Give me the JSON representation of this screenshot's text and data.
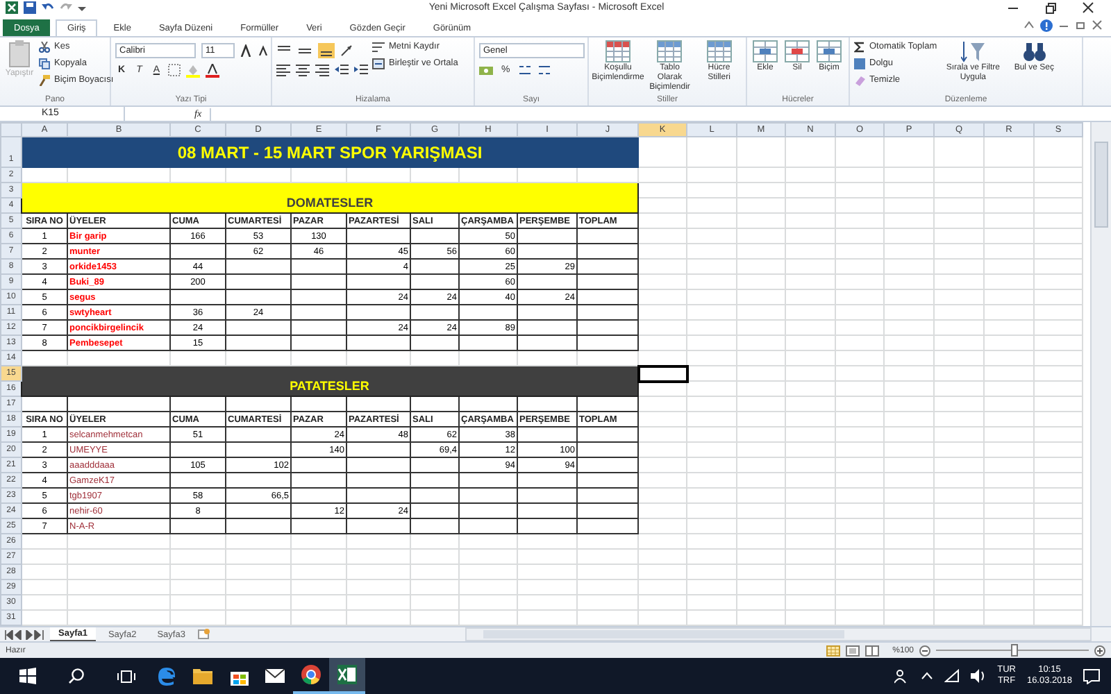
{
  "window": {
    "title": "Yeni Microsoft Excel Çalışma Sayfası - Microsoft Excel"
  },
  "ribbon_tabs": [
    {
      "label": "Dosya",
      "kind": "file",
      "selected": false
    },
    {
      "label": "Giriş",
      "kind": "tab",
      "selected": true
    },
    {
      "label": "Ekle",
      "kind": "tab",
      "selected": false
    },
    {
      "label": "Sayfa Düzeni",
      "kind": "tab",
      "selected": false
    },
    {
      "label": "Formüller",
      "kind": "tab",
      "selected": false
    },
    {
      "label": "Veri",
      "kind": "tab",
      "selected": false
    },
    {
      "label": "Gözden Geçir",
      "kind": "tab",
      "selected": false
    },
    {
      "label": "Görünüm",
      "kind": "tab",
      "selected": false
    }
  ],
  "ribbon": {
    "clipboard": {
      "label": "Pano",
      "paste": {
        "label": "Yapıştır",
        "disabled": true
      },
      "cut": "Kes",
      "copy": "Kopyala",
      "format_painter": "Biçim Boyacısı"
    },
    "font": {
      "label": "Yazı Tipi",
      "family": "Calibri",
      "size": "11",
      "bold": "K",
      "italic": "T",
      "underline": "A"
    },
    "alignment": {
      "label": "Hizalama",
      "wrap": "Metni Kaydır",
      "merge": "Birleştir ve Ortala"
    },
    "number": {
      "label": "Sayı",
      "format": "Genel",
      "percent": "%"
    },
    "styles": {
      "label": "Stiller",
      "buttons": [
        "Koşullu Biçimlendirme",
        "Tablo Olarak Biçimlendir",
        "Hücre Stilleri"
      ]
    },
    "cells": {
      "label": "Hücreler",
      "buttons": [
        "Ekle",
        "Sil",
        "Biçim"
      ]
    },
    "editing": {
      "label": "Düzenleme",
      "autosum": "Otomatik Toplam",
      "fill": "Dolgu",
      "clear": "Temizle",
      "sort": "Sırala ve Filtre Uygula",
      "find": "Bul ve Seç"
    }
  },
  "formula_bar": {
    "name_box": "K15",
    "function_label": "fx"
  },
  "columns": [
    {
      "label": "A",
      "selected": false
    },
    {
      "label": "B",
      "selected": false
    },
    {
      "label": "C",
      "selected": false
    },
    {
      "label": "D",
      "selected": false
    },
    {
      "label": "E",
      "selected": false
    },
    {
      "label": "F",
      "selected": false
    },
    {
      "label": "G",
      "selected": false
    },
    {
      "label": "H",
      "selected": false
    },
    {
      "label": "I",
      "selected": false
    },
    {
      "label": "J",
      "selected": false
    },
    {
      "label": "K",
      "selected": true
    },
    {
      "label": "L",
      "selected": false
    },
    {
      "label": "M",
      "selected": false
    },
    {
      "label": "N",
      "selected": false
    },
    {
      "label": "O",
      "selected": false
    },
    {
      "label": "P",
      "selected": false
    },
    {
      "label": "Q",
      "selected": false
    },
    {
      "label": "R",
      "selected": false
    },
    {
      "label": "S",
      "selected": false
    }
  ],
  "row_headers": [
    {
      "label": "1",
      "selected": false
    },
    {
      "label": "2",
      "selected": false
    },
    {
      "label": "3",
      "selected": false
    },
    {
      "label": "4",
      "selected": false
    },
    {
      "label": "5",
      "selected": false
    },
    {
      "label": "6",
      "selected": false
    },
    {
      "label": "7",
      "selected": false
    },
    {
      "label": "8",
      "selected": false
    },
    {
      "label": "9",
      "selected": false
    },
    {
      "label": "10",
      "selected": false
    },
    {
      "label": "11",
      "selected": false
    },
    {
      "label": "12",
      "selected": false
    },
    {
      "label": "13",
      "selected": false
    },
    {
      "label": "14",
      "selected": false
    },
    {
      "label": "15",
      "selected": true
    },
    {
      "label": "16",
      "selected": false
    },
    {
      "label": "17",
      "selected": false
    },
    {
      "label": "18",
      "selected": false
    },
    {
      "label": "19",
      "selected": false
    },
    {
      "label": "20",
      "selected": false
    },
    {
      "label": "21",
      "selected": false
    },
    {
      "label": "22",
      "selected": false
    },
    {
      "label": "23",
      "selected": false
    },
    {
      "label": "24",
      "selected": false
    },
    {
      "label": "25",
      "selected": false
    },
    {
      "label": "26",
      "selected": false
    },
    {
      "label": "27",
      "selected": false
    },
    {
      "label": "28",
      "selected": false
    },
    {
      "label": "29",
      "selected": false
    },
    {
      "label": "30",
      "selected": false
    },
    {
      "label": "31",
      "selected": false
    }
  ],
  "sheet": {
    "title": "08 MART - 15 MART SPOR YARIŞMASI",
    "sections": [
      {
        "title": "DOMATESLER",
        "color": "#ffff00",
        "names": {
          "color": "#ff0000",
          "bold": true
        },
        "blank_row": false,
        "columns": [
          {
            "label": "SIRA NO",
            "kind": "centered"
          },
          {
            "label": "ÜYELER",
            "kind": "text"
          },
          {
            "label": "CUMA",
            "kind": "centered"
          },
          {
            "label": "CUMARTESİ",
            "kind": "centered"
          },
          {
            "label": "PAZAR",
            "kind": "centered"
          },
          {
            "label": "PAZARTESİ",
            "kind": "numeric"
          },
          {
            "label": "SALI",
            "kind": "numeric"
          },
          {
            "label": "ÇARŞAMBA",
            "kind": "numeric"
          },
          {
            "label": "PERŞEMBE",
            "kind": "numeric"
          },
          {
            "label": "TOPLAM"
          }
        ],
        "rows": [
          {
            "cells": [
              "1",
              "Bir garip",
              "166",
              "53",
              "130",
              null,
              null,
              "50",
              null,
              null
            ]
          },
          {
            "cells": [
              "2",
              "munter",
              null,
              "62",
              "46",
              "45",
              "56",
              "60",
              null,
              null
            ]
          },
          {
            "cells": [
              "3",
              "orkide1453",
              "44",
              null,
              null,
              "4",
              null,
              "25",
              "29",
              null
            ]
          },
          {
            "cells": [
              "4",
              "Buki_89",
              "200",
              null,
              null,
              null,
              null,
              "60",
              null,
              null
            ]
          },
          {
            "cells": [
              "5",
              "segus",
              null,
              null,
              null,
              "24",
              "24",
              "40",
              "24",
              null
            ]
          },
          {
            "cells": [
              "6",
              "swtyheart",
              "36",
              "24",
              null,
              null,
              null,
              null,
              null,
              null
            ]
          },
          {
            "cells": [
              "7",
              "poncikbirgelincik",
              "24",
              null,
              null,
              "24",
              "24",
              "89",
              null,
              null
            ]
          },
          {
            "cells": [
              "8",
              "Pembesepet",
              "15",
              null,
              null,
              null,
              null,
              null,
              null,
              null
            ]
          }
        ]
      },
      {
        "title": "PATATESLER",
        "color": "#404040",
        "names": {
          "color": "#a0303a",
          "bold": false
        },
        "blank_row": true,
        "columns": [
          {
            "label": "SIRA NO",
            "kind": "centered"
          },
          {
            "label": "ÜYELER",
            "kind": "text"
          },
          {
            "label": "CUMA",
            "kind": "centered"
          },
          {
            "label": "CUMARTESİ",
            "kind": "numeric"
          },
          {
            "label": "PAZAR",
            "kind": "numeric"
          },
          {
            "label": "PAZARTESİ",
            "kind": "numeric"
          },
          {
            "label": "SALI",
            "kind": "numeric"
          },
          {
            "label": "ÇARŞAMBA",
            "kind": "numeric"
          },
          {
            "label": "PERŞEMBE",
            "kind": "numeric"
          },
          {
            "label": "TOPLAM"
          }
        ],
        "rows": [
          {
            "cells": [
              "1",
              "selcanmehmetcan",
              "51",
              null,
              "24",
              "48",
              "62",
              "38",
              null,
              null
            ]
          },
          {
            "cells": [
              "2",
              "UMEYYE",
              null,
              null,
              "140",
              null,
              "69,4",
              "12",
              "100",
              null
            ]
          },
          {
            "cells": [
              "3",
              "aaadddaaa",
              "105",
              "102",
              null,
              null,
              null,
              "94",
              "94",
              null
            ]
          },
          {
            "cells": [
              "4",
              "GamzeK17",
              null,
              null,
              null,
              null,
              null,
              null,
              null,
              null
            ]
          },
          {
            "cells": [
              "5",
              "tgb1907",
              "58",
              "66,5",
              null,
              null,
              null,
              null,
              null,
              null
            ]
          },
          {
            "cells": [
              "6",
              "nehir-60",
              "8",
              null,
              "12",
              "24",
              null,
              null,
              null,
              null
            ]
          },
          {
            "cells": [
              "7",
              "N-A-R",
              null,
              null,
              null,
              null,
              null,
              null,
              null,
              null
            ]
          }
        ]
      }
    ]
  },
  "sheet_tabs": [
    {
      "label": "Sayfa1",
      "selected": true
    },
    {
      "label": "Sayfa2",
      "selected": false
    },
    {
      "label": "Sayfa3",
      "selected": false
    }
  ],
  "status_bar": {
    "text": "Hazır",
    "zoom": {
      "label": "%100",
      "level": 0.5
    }
  },
  "taskbar": {
    "apps": [
      {
        "kind": "edge",
        "running": false,
        "selected": false
      },
      {
        "kind": "folder",
        "running": false,
        "selected": false
      },
      {
        "kind": "store",
        "running": false,
        "selected": false
      },
      {
        "kind": "mail",
        "running": false,
        "selected": false
      },
      {
        "kind": "chrome",
        "running": true,
        "selected": false
      },
      {
        "kind": "excel",
        "running": true,
        "selected": true
      }
    ],
    "language": [
      "TUR",
      "TRF"
    ],
    "time": "10:15",
    "date": "16.03.2018"
  }
}
